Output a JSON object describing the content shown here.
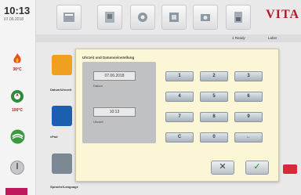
{
  "status": {
    "time": "10:13",
    "date": "07.06.2018"
  },
  "sidebar": {
    "temp_label": "30°C",
    "vacuum_label": "",
    "green_label": "100°C"
  },
  "header": {
    "brand": "VITA",
    "sub1": "1 Ready",
    "sub2": "Laber"
  },
  "background": {
    "tile1_label": "Datum/Uhrzeit",
    "tile2_label": "vPad",
    "tile3_label": "Sprache/Language"
  },
  "dialog": {
    "title": "Uhrzeit und Datumseinstellung",
    "date_value": "07.06.2018",
    "date_caption": "Datum",
    "time_value": "10:13",
    "time_caption": "Uhrzeit",
    "keys": [
      "1",
      "2",
      "3",
      "4",
      "5",
      "6",
      "7",
      "8",
      "9",
      "C",
      "0",
      "←"
    ],
    "cancel": "✕",
    "confirm": "✓"
  },
  "colors": {
    "accent": "#b3182a",
    "dialog_bg": "#fbf6d6"
  }
}
